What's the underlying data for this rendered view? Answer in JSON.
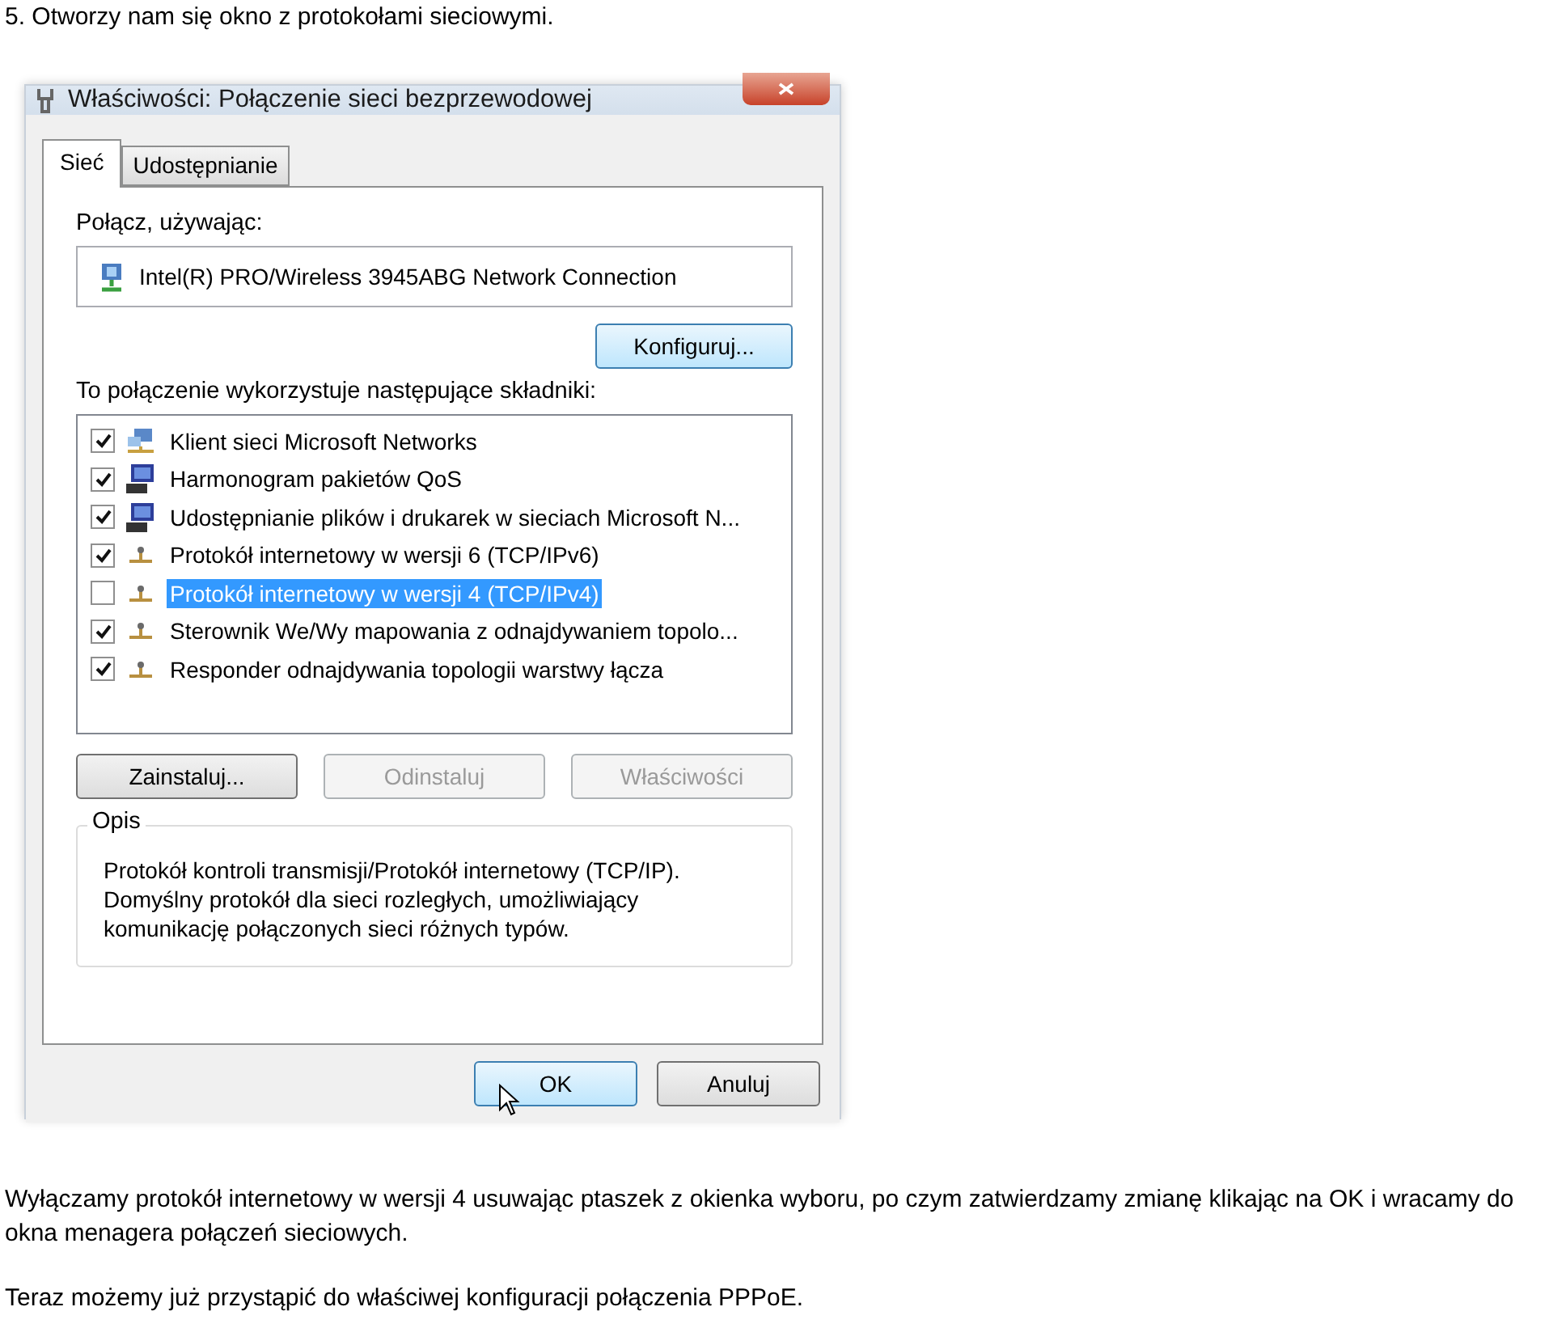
{
  "heading": "5. Otworzy nam się okno z protokołami sieciowymi.",
  "window": {
    "title": "Właściwości: Połączenie sieci bezprzewodowej"
  },
  "tabs": [
    {
      "label": "Sieć",
      "selected": true
    },
    {
      "label": "Udostępnianie",
      "selected": false
    }
  ],
  "connect_label": "Połącz, używając:",
  "adapter": "Intel(R) PRO/Wireless 3945ABG Network Connection",
  "configure_button": "Konfiguruj...",
  "components_label": "To połączenie wykorzystuje następujące składniki:",
  "components": [
    {
      "label": "Klient sieci Microsoft Networks",
      "kind": "client",
      "checked": true,
      "selected": false
    },
    {
      "label": "Harmonogram pakietów QoS",
      "kind": "service",
      "checked": true,
      "selected": false
    },
    {
      "label": "Udostępnianie plików i drukarek w sieciach Microsoft N...",
      "kind": "service",
      "checked": true,
      "selected": false
    },
    {
      "label": "Protokół internetowy w wersji 6 (TCP/IPv6)",
      "kind": "protocol",
      "checked": true,
      "selected": false
    },
    {
      "label": "Protokół internetowy w wersji 4 (TCP/IPv4)",
      "kind": "protocol",
      "checked": false,
      "selected": true
    },
    {
      "label": "Sterownik We/Wy mapowania z odnajdywaniem topolo...",
      "kind": "protocol",
      "checked": true,
      "selected": false
    },
    {
      "label": "Responder odnajdywania topologii warstwy łącza",
      "kind": "protocol",
      "checked": true,
      "selected": false
    }
  ],
  "component_buttons": [
    {
      "label": "Zainstaluj...",
      "disabled": false
    },
    {
      "label": "Odinstaluj",
      "disabled": true
    },
    {
      "label": "Właściwości",
      "disabled": true
    }
  ],
  "description": {
    "title": "Opis",
    "text": "Protokół kontroli transmisji/Protokół internetowy (TCP/IP). Domyślny protokół dla sieci rozległych, umożliwiający komunikację połączonych sieci różnych typów."
  },
  "dialog_buttons": [
    {
      "label": "OK",
      "default": true
    },
    {
      "label": "Anuluj",
      "default": false
    }
  ],
  "paragraphs": [
    "Wyłączamy protokół internetowy w wersji 4 usuwając ptaszek z okienka wyboru, po czym zatwierdzamy zmianę klikając na OK i wracamy do okna menagera połączeń sieciowych.",
    "Teraz możemy już przystąpić do właściwej konfiguracji połączenia PPPoE."
  ]
}
